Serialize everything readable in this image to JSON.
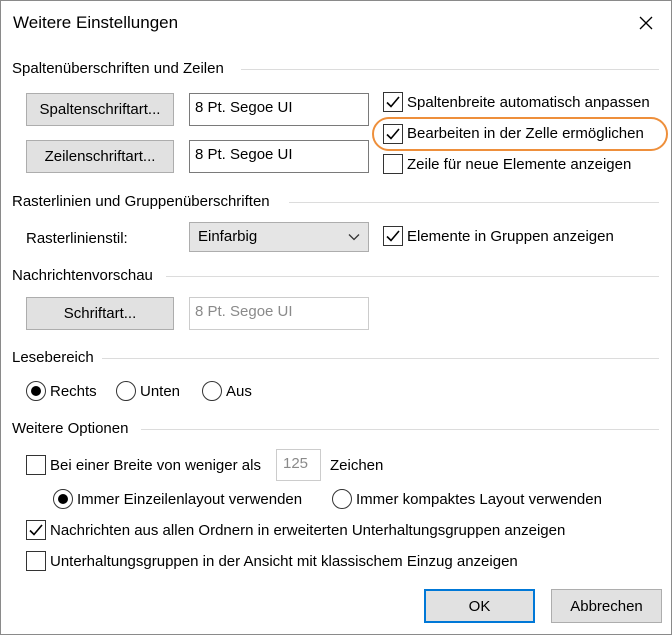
{
  "window": {
    "title": "Weitere Einstellungen"
  },
  "columns": {
    "group_title": "Spaltenüberschriften und Zeilen",
    "column_font_button": "Spaltenschriftart...",
    "column_font_value": "8 Pt. Segoe UI",
    "row_font_button": "Zeilenschriftart...",
    "row_font_value": "8 Pt. Segoe UI",
    "auto_width_label": "Spaltenbreite automatisch anpassen",
    "auto_width_checked": true,
    "inline_edit_label": "Bearbeiten in der Zelle ermöglichen",
    "inline_edit_checked": true,
    "new_items_row_label": "Zeile für neue Elemente anzeigen",
    "new_items_row_checked": false
  },
  "gridlines": {
    "group_title": "Rasterlinien und Gruppenüberschriften",
    "style_label": "Rasterlinienstil:",
    "style_value": "Einfarbig",
    "show_in_groups_label": "Elemente in Gruppen anzeigen",
    "show_in_groups_checked": true
  },
  "preview": {
    "group_title": "Nachrichtenvorschau",
    "font_button": "Schriftart...",
    "font_value": "8 Pt. Segoe UI"
  },
  "reading_pane": {
    "group_title": "Lesebereich",
    "options": [
      {
        "label": "Rechts",
        "selected": true
      },
      {
        "label": "Unten",
        "selected": false
      },
      {
        "label": "Aus",
        "selected": false
      }
    ]
  },
  "other": {
    "group_title": "Weitere Optionen",
    "width_label_before": "Bei einer Breite von weniger als",
    "width_value": "125",
    "width_label_after": "Zeichen",
    "width_checked": false,
    "single_line_label": "Immer Einzeilenlayout verwenden",
    "single_line_selected": true,
    "compact_label": "Immer kompaktes Layout verwenden",
    "compact_selected": false,
    "all_folders_label": "Nachrichten aus allen Ordnern in erweiterten Unterhaltungsgruppen anzeigen",
    "all_folders_checked": true,
    "classic_indent_label": "Unterhaltungsgruppen in der Ansicht mit klassischem Einzug anzeigen",
    "classic_indent_checked": false
  },
  "footer": {
    "ok_label": "OK",
    "cancel_label": "Abbrechen"
  },
  "colors": {
    "highlight": "#ee8f3b",
    "default_button_border": "#0078d7"
  }
}
